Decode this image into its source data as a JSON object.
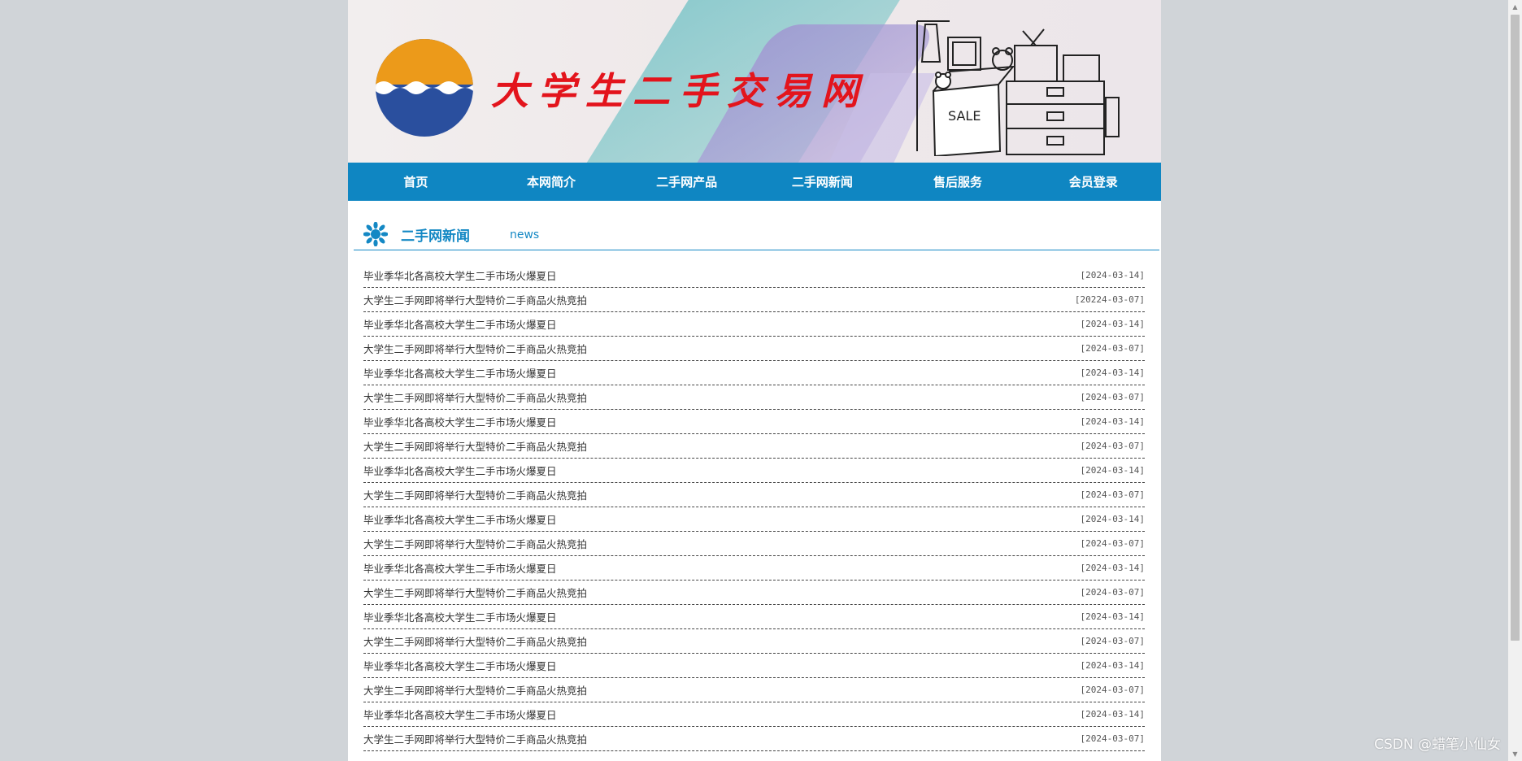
{
  "header": {
    "site_title": "大学生二手交易网",
    "sale_sign": "SALE"
  },
  "nav": {
    "items": [
      "首页",
      "本网简介",
      "二手网产品",
      "二手网新闻",
      "售后服务",
      "会员登录"
    ]
  },
  "section": {
    "title": "二手网新闻",
    "subtitle": "news"
  },
  "news": [
    {
      "title": "毕业季华北各高校大学生二手市场火爆夏日",
      "date": "[2024-03-14]"
    },
    {
      "title": "大学生二手网即将举行大型特价二手商品火热竞拍",
      "date": "[20224-03-07]"
    },
    {
      "title": "毕业季华北各高校大学生二手市场火爆夏日",
      "date": "[2024-03-14]"
    },
    {
      "title": "大学生二手网即将举行大型特价二手商品火热竞拍",
      "date": "[2024-03-07]"
    },
    {
      "title": "毕业季华北各高校大学生二手市场火爆夏日",
      "date": "[2024-03-14]"
    },
    {
      "title": "大学生二手网即将举行大型特价二手商品火热竞拍",
      "date": "[2024-03-07]"
    },
    {
      "title": "毕业季华北各高校大学生二手市场火爆夏日",
      "date": "[2024-03-14]"
    },
    {
      "title": "大学生二手网即将举行大型特价二手商品火热竞拍",
      "date": "[2024-03-07]"
    },
    {
      "title": "毕业季华北各高校大学生二手市场火爆夏日",
      "date": "[2024-03-14]"
    },
    {
      "title": "大学生二手网即将举行大型特价二手商品火热竞拍",
      "date": "[2024-03-07]"
    },
    {
      "title": "毕业季华北各高校大学生二手市场火爆夏日",
      "date": "[2024-03-14]"
    },
    {
      "title": "大学生二手网即将举行大型特价二手商品火热竞拍",
      "date": "[2024-03-07]"
    },
    {
      "title": "毕业季华北各高校大学生二手市场火爆夏日",
      "date": "[2024-03-14]"
    },
    {
      "title": "大学生二手网即将举行大型特价二手商品火热竞拍",
      "date": "[2024-03-07]"
    },
    {
      "title": "毕业季华北各高校大学生二手市场火爆夏日",
      "date": "[2024-03-14]"
    },
    {
      "title": "大学生二手网即将举行大型特价二手商品火热竞拍",
      "date": "[2024-03-07]"
    },
    {
      "title": "毕业季华北各高校大学生二手市场火爆夏日",
      "date": "[2024-03-14]"
    },
    {
      "title": "大学生二手网即将举行大型特价二手商品火热竞拍",
      "date": "[2024-03-07]"
    },
    {
      "title": "毕业季华北各高校大学生二手市场火爆夏日",
      "date": "[2024-03-14]"
    },
    {
      "title": "大学生二手网即将举行大型特价二手商品火热竞拍",
      "date": "[2024-03-07]"
    }
  ],
  "watermark": "CSDN @蜡笔小仙女",
  "colors": {
    "nav_bg": "#0f86c2",
    "accent": "#1488c4",
    "title_red": "#e3141c",
    "logo_orange": "#ec9a1a",
    "logo_blue": "#2a4f9e",
    "page_bg": "#d0d4d8"
  }
}
